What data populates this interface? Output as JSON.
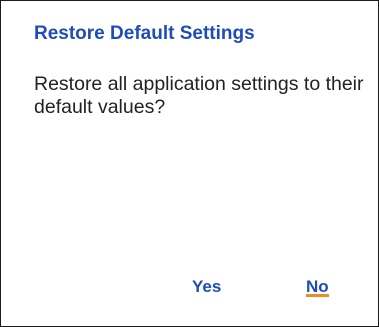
{
  "dialog": {
    "title": "Restore Default Settings",
    "message": "Restore all application settings to their default values?",
    "buttons": {
      "yes_label": "Yes",
      "no_label": "No"
    },
    "focused_button": "no",
    "colors": {
      "accent": "#1f4db8",
      "text": "#222222",
      "focus_indicator": "#f08a24",
      "background": "#ffffff",
      "border": "#1a1a1a"
    }
  }
}
